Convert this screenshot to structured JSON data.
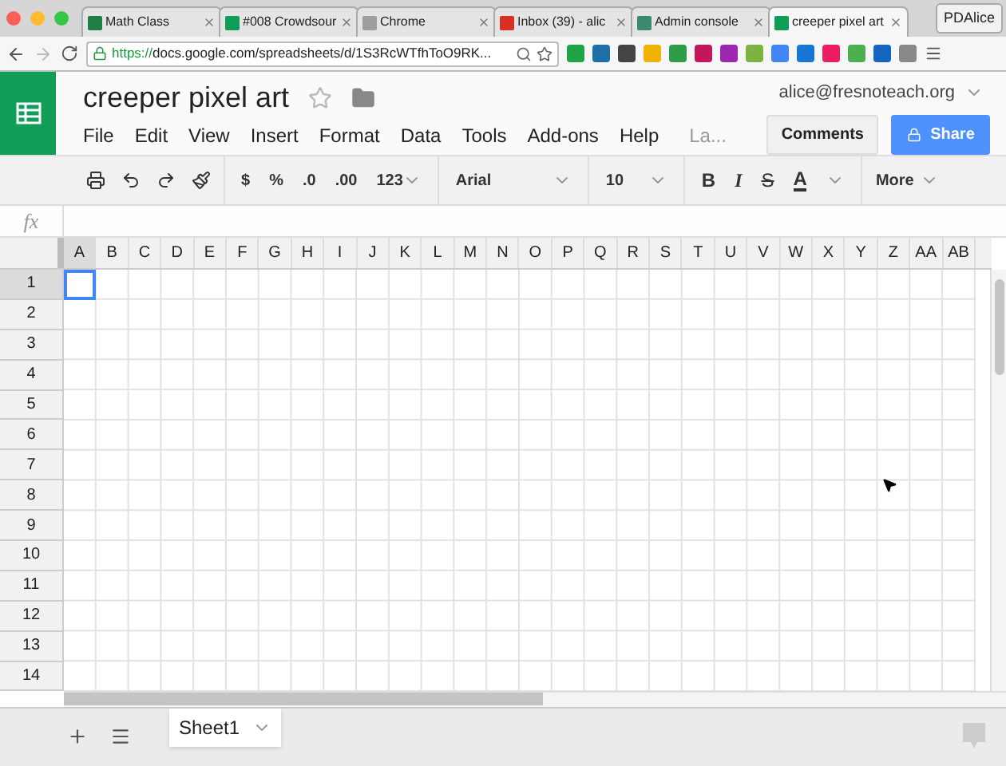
{
  "browser": {
    "tabs": [
      {
        "title": "Math Class",
        "color": "#1e7e45",
        "selected": false
      },
      {
        "title": "#008 Crowdsour",
        "color": "#0f9d58",
        "selected": false
      },
      {
        "title": "Chrome",
        "color": "#9e9e9e",
        "selected": false
      },
      {
        "title": "Inbox (39) - alic",
        "color": "#d93025",
        "selected": false
      },
      {
        "title": "Admin console",
        "color": "#3c8a6e",
        "selected": false
      },
      {
        "title": "creeper pixel art",
        "color": "#0f9d58",
        "selected": true
      }
    ],
    "profile": "PDAlice",
    "url_scheme": "https://",
    "url_rest": "docs.google.com/spreadsheets/d/1S3RcWTfhToO9RK..."
  },
  "doc": {
    "title": "creeper pixel art",
    "account": "alice@fresnoteach.org",
    "menu": [
      "File",
      "Edit",
      "View",
      "Insert",
      "Format",
      "Data",
      "Tools",
      "Add-ons",
      "Help",
      "La..."
    ],
    "comments": "Comments",
    "share": "Share"
  },
  "toolbar": {
    "currency": "$",
    "percent": "%",
    "decimal_less": ".0",
    "decimal_more": ".00",
    "number_format": "123",
    "font": "Arial",
    "size": "10",
    "bold": "B",
    "italic": "I",
    "strike": "S",
    "text_color": "A",
    "more": "More"
  },
  "formula_bar": {
    "label": "fx"
  },
  "sheet": {
    "columns": [
      {
        "label": "A",
        "selected": true
      },
      {
        "label": "B",
        "selected": false
      },
      {
        "label": "C",
        "selected": false
      },
      {
        "label": "D",
        "selected": false
      },
      {
        "label": "E",
        "selected": false
      },
      {
        "label": "F",
        "selected": false
      },
      {
        "label": "G",
        "selected": false
      },
      {
        "label": "H",
        "selected": false
      },
      {
        "label": "I",
        "selected": false
      },
      {
        "label": "J",
        "selected": false
      },
      {
        "label": "K",
        "selected": false
      },
      {
        "label": "L",
        "selected": false
      },
      {
        "label": "M",
        "selected": false
      },
      {
        "label": "N",
        "selected": false
      },
      {
        "label": "O",
        "selected": false
      },
      {
        "label": "P",
        "selected": false
      },
      {
        "label": "Q",
        "selected": false
      },
      {
        "label": "R",
        "selected": false
      },
      {
        "label": "S",
        "selected": false
      },
      {
        "label": "T",
        "selected": false
      },
      {
        "label": "U",
        "selected": false
      },
      {
        "label": "V",
        "selected": false
      },
      {
        "label": "W",
        "selected": false
      },
      {
        "label": "X",
        "selected": false
      },
      {
        "label": "Y",
        "selected": false
      },
      {
        "label": "Z",
        "selected": false
      },
      {
        "label": "AA",
        "selected": false
      },
      {
        "label": "AB",
        "selected": false
      }
    ],
    "rows": [
      {
        "label": "1",
        "selected": true
      },
      {
        "label": "2",
        "selected": false
      },
      {
        "label": "3",
        "selected": false
      },
      {
        "label": "4",
        "selected": false
      },
      {
        "label": "5",
        "selected": false
      },
      {
        "label": "6",
        "selected": false
      },
      {
        "label": "7",
        "selected": false
      },
      {
        "label": "8",
        "selected": false
      },
      {
        "label": "9",
        "selected": false
      },
      {
        "label": "10",
        "selected": false
      },
      {
        "label": "11",
        "selected": false
      },
      {
        "label": "12",
        "selected": false
      },
      {
        "label": "13",
        "selected": false
      },
      {
        "label": "14",
        "selected": false
      }
    ]
  },
  "sheet_tabs": [
    {
      "label": "Sheet1",
      "selected": true
    }
  ]
}
